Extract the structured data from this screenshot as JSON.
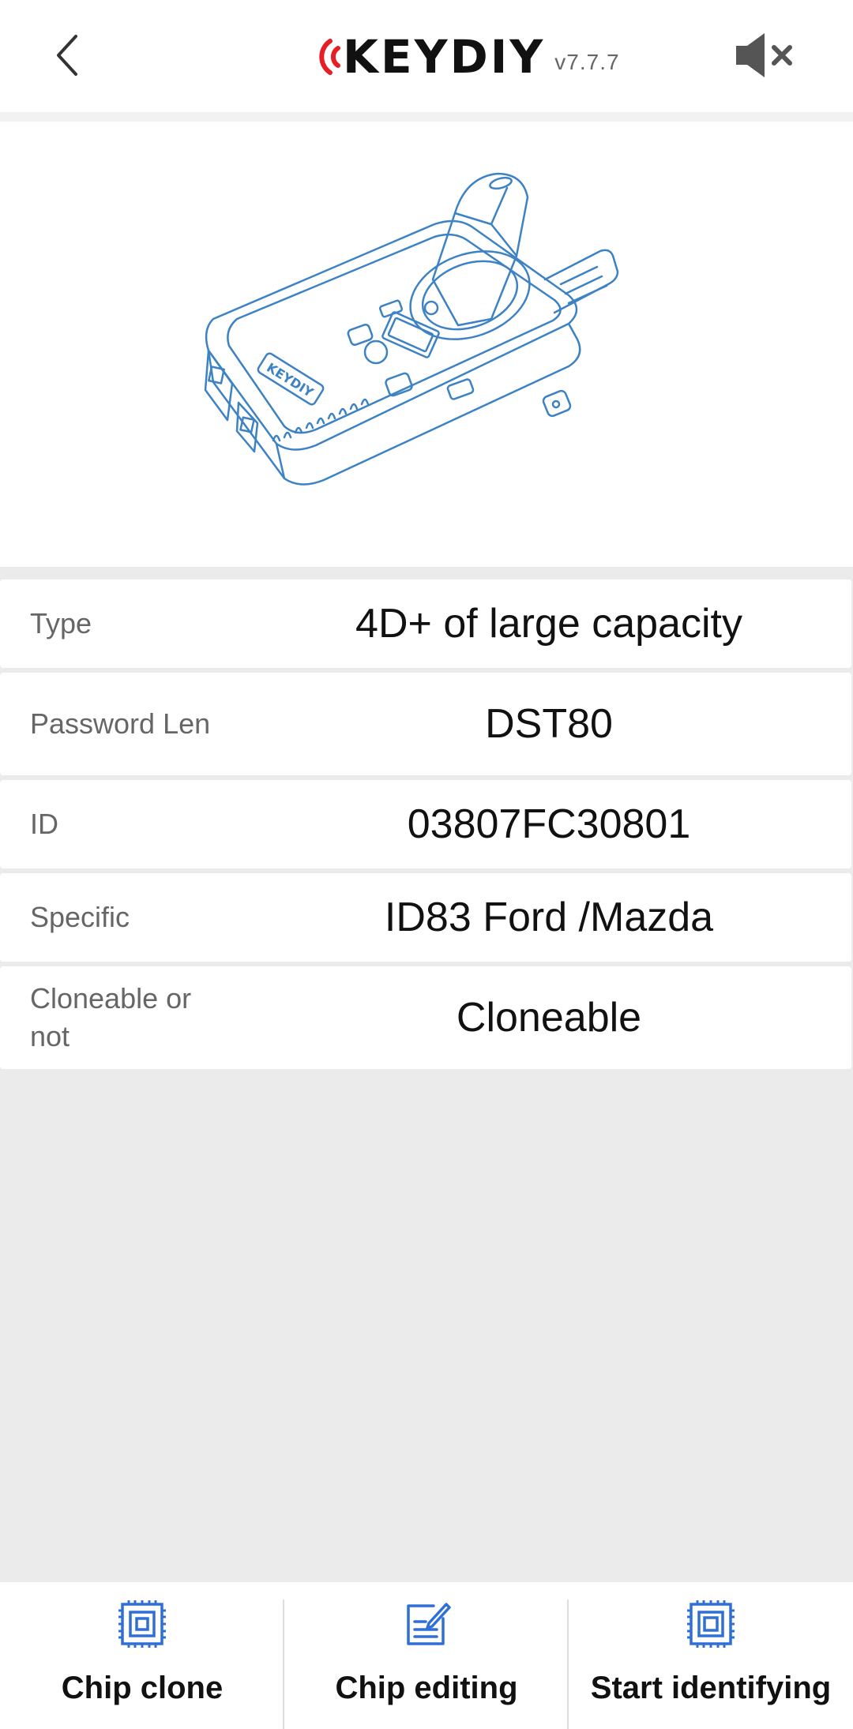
{
  "header": {
    "logo_text": "KEYDIY",
    "version": "v7.7.7",
    "back_icon": "chevron-left-icon",
    "mute_icon": "speaker-muted-icon",
    "logo_accent_color": "#e61e25"
  },
  "info": {
    "rows": [
      {
        "label": "Type",
        "value": "4D+ of large capacity"
      },
      {
        "label": "Password Len",
        "value": "DST80"
      },
      {
        "label": "ID",
        "value": "03807FC30801"
      },
      {
        "label": "Specific",
        "value": "ID83 Ford /Mazda"
      },
      {
        "label": "Cloneable or not",
        "value": "Cloneable"
      }
    ]
  },
  "toolbar": {
    "icon_color": "#2f6fd6",
    "items": [
      {
        "label": "Chip clone",
        "icon": "chip-icon"
      },
      {
        "label": "Chip editing",
        "icon": "edit-document-icon"
      },
      {
        "label": "Start identifying",
        "icon": "chip-scan-icon"
      }
    ]
  }
}
